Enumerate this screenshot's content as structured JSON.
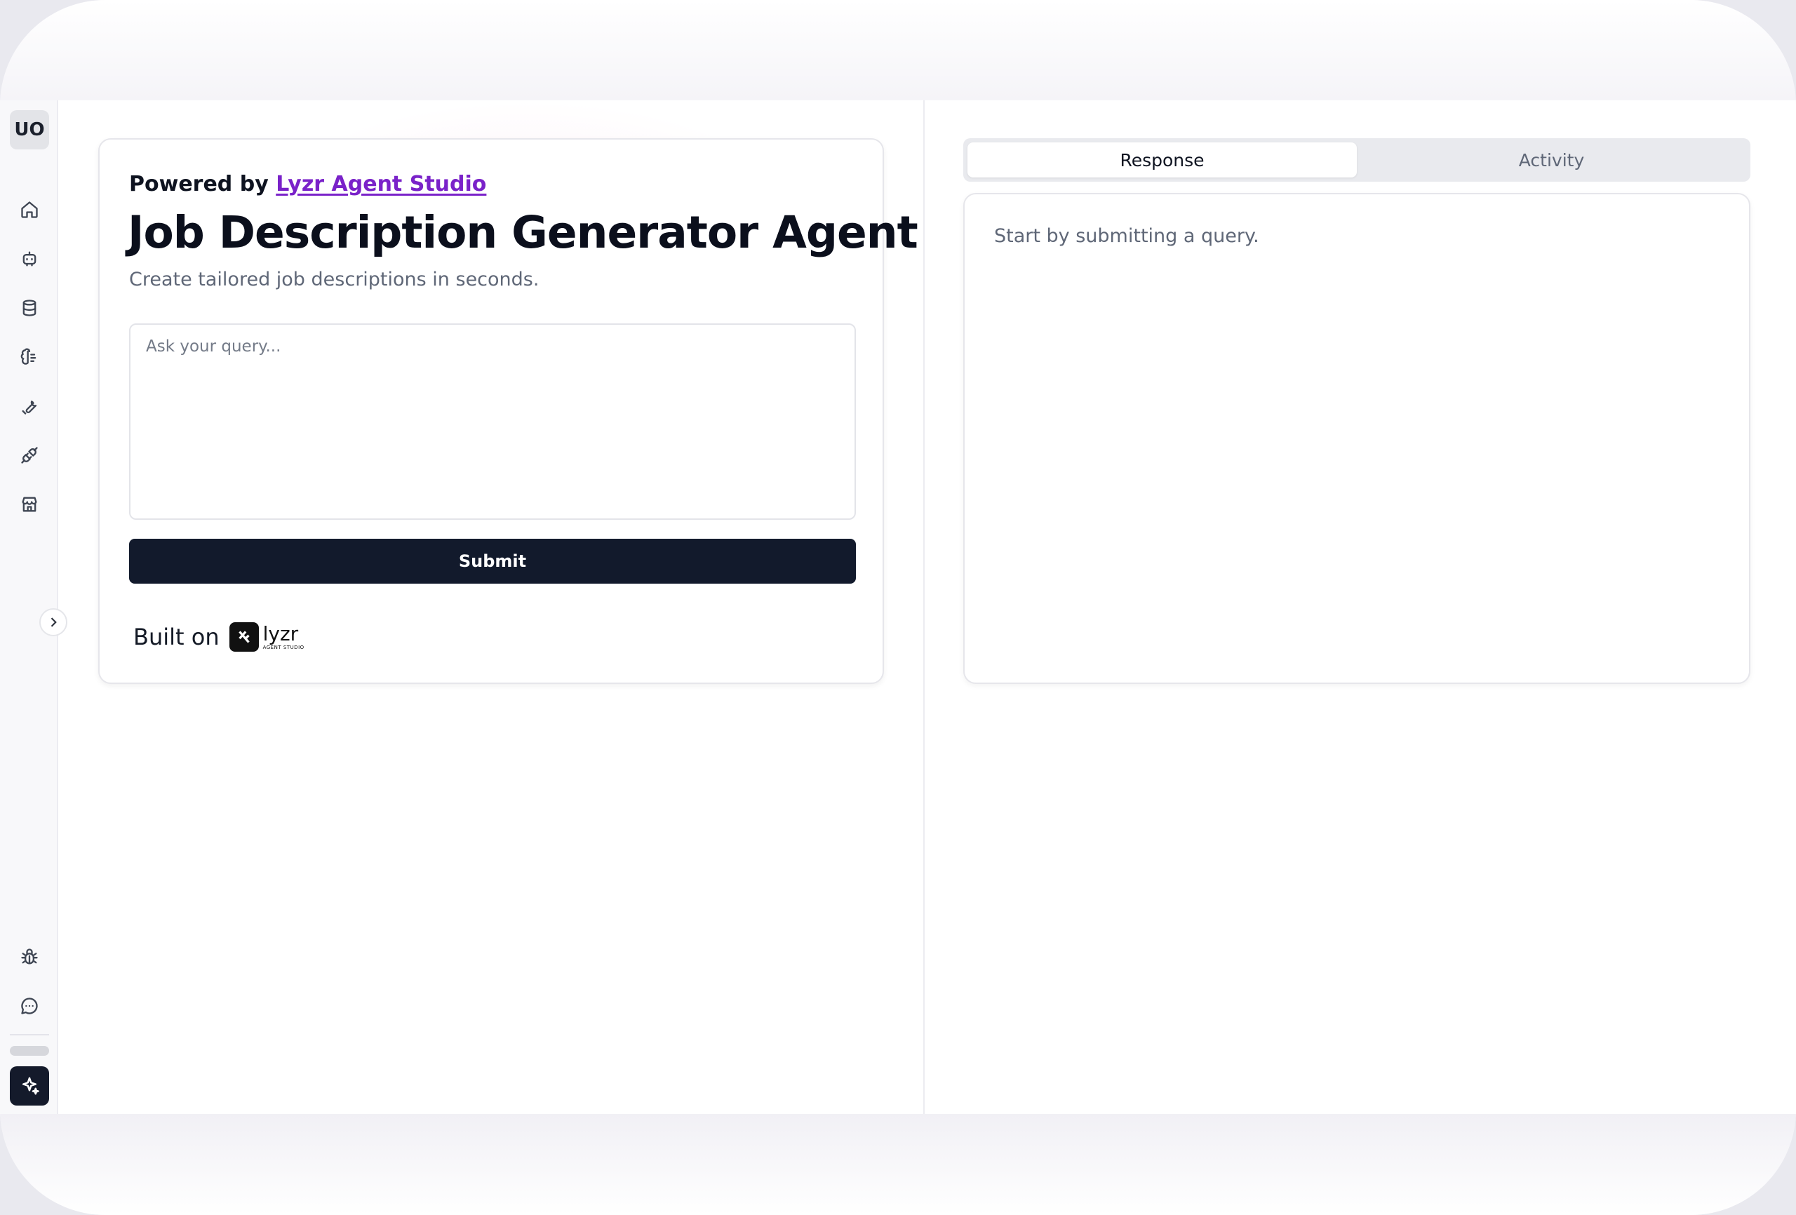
{
  "sidebar": {
    "avatar_initials": "UO",
    "nav_icons": [
      "home-icon",
      "agent-icon",
      "database-icon",
      "brain-icon",
      "tools-icon",
      "plugin-icon",
      "store-icon"
    ],
    "bottom_icons": [
      "bug-icon",
      "chat-icon"
    ],
    "footer_action_icon": "sparkles-icon"
  },
  "agent_card": {
    "powered_by_prefix": "Powered by",
    "powered_by_link": "Lyzr Agent Studio",
    "title": "Job Description Generator Agent",
    "subtitle": "Create tailored job descriptions in seconds.",
    "query_placeholder": "Ask your query...",
    "query_value": "",
    "submit_label": "Submit",
    "built_on_label": "Built on",
    "logo_name": "lyzr",
    "logo_sub": "AGENT STUDIO"
  },
  "output": {
    "tabs": [
      {
        "label": "Response",
        "active": true
      },
      {
        "label": "Activity",
        "active": false
      }
    ],
    "empty_message": "Start by submitting a query."
  },
  "colors": {
    "accent_link": "#7a22c9",
    "primary_button": "#121a2c"
  }
}
